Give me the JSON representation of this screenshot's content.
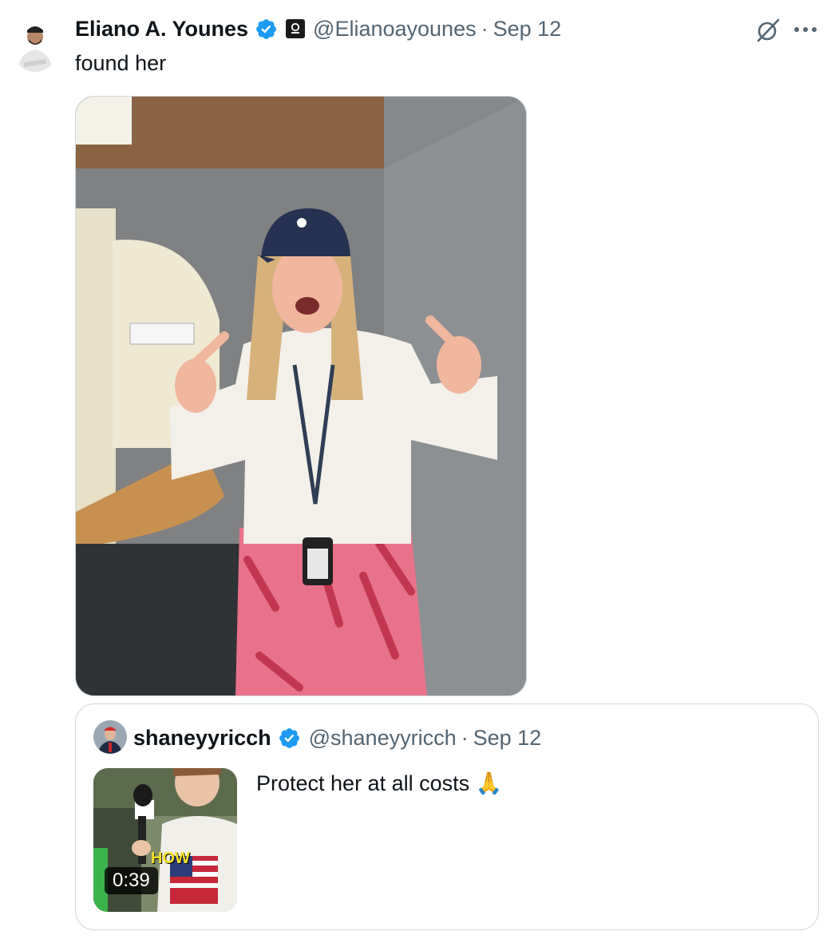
{
  "tweet": {
    "author_name": "Eliano A. Younes",
    "handle": "@Elianoayounes",
    "separator": "·",
    "date": "Sep 12",
    "text": "found her",
    "icons": {
      "verified": "verified-badge-icon",
      "affiliation": "affiliation-badge-icon",
      "grok": "grok-icon",
      "more": "more-icon"
    }
  },
  "quote": {
    "author_name": "shaneyyricch",
    "handle": "@shaneyyricch",
    "separator": "·",
    "date": "Sep 12",
    "text": "Protect her at all costs 🙏",
    "video": {
      "duration": "0:39",
      "caption_overlay": "HOW"
    }
  },
  "colors": {
    "verified_blue": "#1d9bf0",
    "secondary_text": "#536471",
    "border": "#cfd9de"
  }
}
